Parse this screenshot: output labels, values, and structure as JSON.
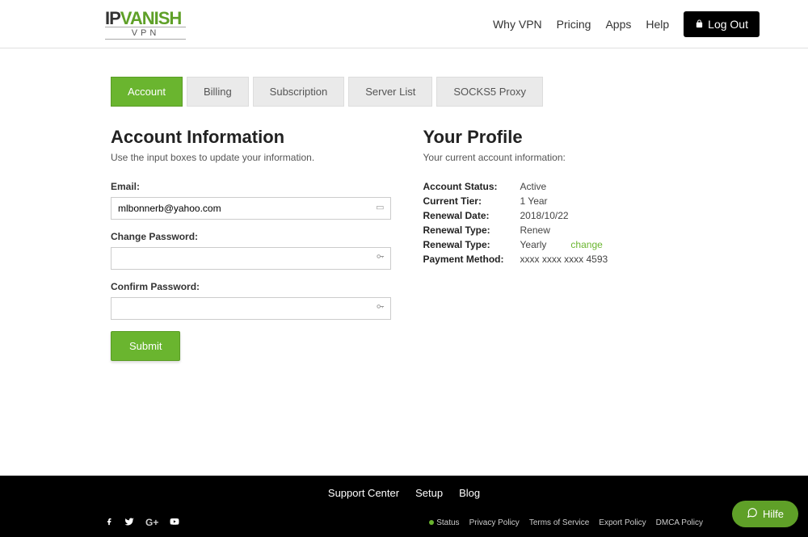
{
  "logo": {
    "ip": "IP",
    "vanish": "VANISH",
    "sub": "VPN"
  },
  "nav": {
    "why": "Why VPN",
    "pricing": "Pricing",
    "apps": "Apps",
    "help": "Help",
    "logout": "Log Out"
  },
  "tabs": {
    "account": "Account",
    "billing": "Billing",
    "subscription": "Subscription",
    "server": "Server List",
    "socks": "SOCKS5 Proxy"
  },
  "account_info": {
    "title": "Account Information",
    "subtitle": "Use the input boxes to update your information.",
    "email_label": "Email:",
    "email_value": "mlbonnerb@yahoo.com",
    "change_pw_label": "Change Password:",
    "confirm_pw_label": "Confirm Password:",
    "submit": "Submit"
  },
  "profile": {
    "title": "Your Profile",
    "subtitle": "Your current account information:",
    "rows": [
      {
        "key": "Account Status:",
        "val": "Active"
      },
      {
        "key": "Current Tier:",
        "val": "1 Year"
      },
      {
        "key": "Renewal Date:",
        "val": "2018/10/22"
      },
      {
        "key": "Renewal Type:",
        "val": "Renew"
      },
      {
        "key": "Renewal Type:",
        "val": "Yearly"
      },
      {
        "key": "Payment Method:",
        "val": "xxxx xxxx xxxx 4593"
      }
    ],
    "change": "change"
  },
  "footer": {
    "support": "Support Center",
    "setup": "Setup",
    "blog": "Blog",
    "status": "Status",
    "privacy": "Privacy Policy",
    "tos": "Terms of Service",
    "export": "Export Policy",
    "dmca": "DMCA Policy"
  },
  "help_widget": "Hilfe"
}
